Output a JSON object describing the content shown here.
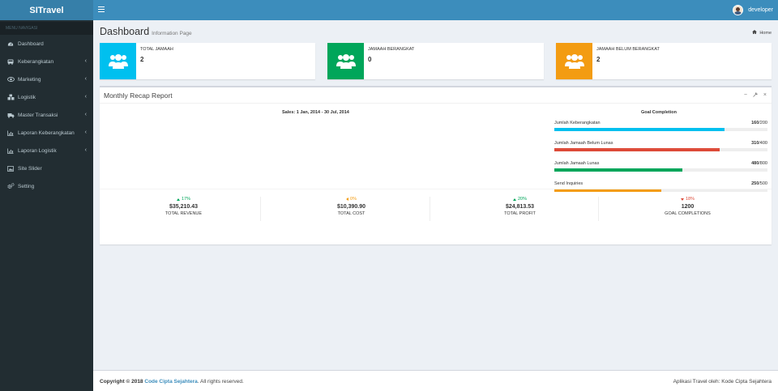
{
  "app": {
    "logo": "SITravel",
    "user_name": "developer"
  },
  "sidebar": {
    "header": "MENU NAVIGASI",
    "items": [
      {
        "label": "Dashboard",
        "icon": "dashboard-icon",
        "has_children": false
      },
      {
        "label": "Keberangkatan",
        "icon": "bus-icon",
        "has_children": true
      },
      {
        "label": "Marketing",
        "icon": "eye-icon",
        "has_children": true
      },
      {
        "label": "Logistik",
        "icon": "cubes-icon",
        "has_children": true
      },
      {
        "label": "Master Transaksi",
        "icon": "truck-icon",
        "has_children": true
      },
      {
        "label": "Laporan Keberangkatan",
        "icon": "bar-chart-icon",
        "has_children": true
      },
      {
        "label": "Laporan Logistik",
        "icon": "bar-chart-icon",
        "has_children": true
      },
      {
        "label": "Site Slider",
        "icon": "image-icon",
        "has_children": false
      },
      {
        "label": "Setting",
        "icon": "cogs-icon",
        "has_children": false
      }
    ]
  },
  "page": {
    "title": "Dashboard",
    "subtitle": "Information Page",
    "breadcrumb": "Home"
  },
  "info_boxes": [
    {
      "label": "TOTAL JAMAAH",
      "value": "2",
      "color": "#00c0ef",
      "icon": "users-icon"
    },
    {
      "label": "JAMAAH BERANGKAT",
      "value": "0",
      "color": "#00a65a",
      "icon": "users-icon"
    },
    {
      "label": "JAMAAH BELUM BERANGKAT",
      "value": "2",
      "color": "#f39c12",
      "icon": "users-icon"
    }
  ],
  "recap": {
    "title": "Monthly Recap Report",
    "sales_title": "Sales: 1 Jan, 2014 - 30 Jul, 2014",
    "goal_title": "Goal Completion",
    "goals": [
      {
        "label": "Jumlah Keberangkatan",
        "done": "160",
        "total": "/200",
        "fraction": 0.8,
        "color": "#00c0ef"
      },
      {
        "label": "Jumlah Jamaah Belum Lunas",
        "done": "310",
        "total": "/400",
        "fraction": 0.775,
        "color": "#dd4b39"
      },
      {
        "label": "Jumlah Jamaah Lunas",
        "done": "480",
        "total": "/800",
        "fraction": 0.6,
        "color": "#00a65a"
      },
      {
        "label": "Send Inquiries",
        "done": "250",
        "total": "/500",
        "fraction": 0.5,
        "color": "#f39c12"
      }
    ],
    "descriptions": [
      {
        "pct": "17%",
        "direction": "up",
        "color": "#00a65a",
        "amount": "$35,210.43",
        "label": "TOTAL REVENUE"
      },
      {
        "pct": "0%",
        "direction": "left",
        "color": "#f39c12",
        "amount": "$10,390.90",
        "label": "TOTAL COST"
      },
      {
        "pct": "20%",
        "direction": "up",
        "color": "#00a65a",
        "amount": "$24,813.53",
        "label": "TOTAL PROFIT"
      },
      {
        "pct": "18%",
        "direction": "down",
        "color": "#dd4b39",
        "amount": "1200",
        "label": "GOAL COMPLETIONS"
      }
    ]
  },
  "footer": {
    "copyright_prefix": "Copyright © 2018",
    "company": "Code Cipta Sejahtera",
    "copyright_suffix": ". All rights reserved.",
    "credits": "Aplikasi Travel oleh: Kode Cipta Sejahtera"
  }
}
